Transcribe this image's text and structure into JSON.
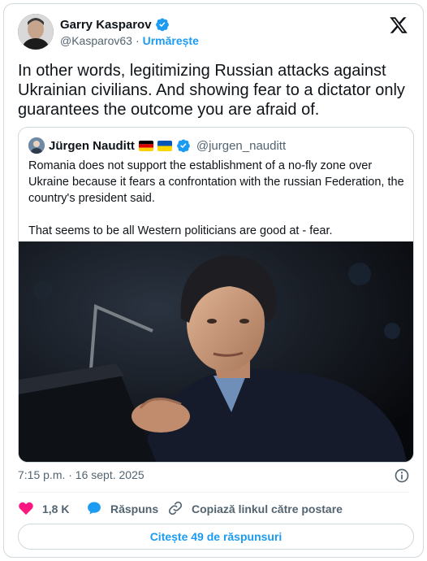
{
  "author": {
    "name": "Garry Kasparov",
    "handle": "@Kasparov63",
    "separator": "·",
    "follow_label": "Urmărește"
  },
  "tweet": {
    "text": "In other words, legitimizing Russian attacks against Ukrainian civilians. And showing fear to a dictator only guarantees the outcome you are afraid of."
  },
  "quote": {
    "name": "Jürgen Nauditt",
    "flags": [
      "germany-flag",
      "ukraine-flag"
    ],
    "handle": "@jurgen_nauditt",
    "text": "Romania does not support the establishment of a no-fly zone over Ukraine because it fears a confrontation with the russian Federation, the country's president said.\n\nThat seems to be all Western politicians are good at - fear."
  },
  "meta": {
    "timestamp": "7:15 p.m. · 16 sept. 2025"
  },
  "actions": {
    "like_count": "1,8 K",
    "reply_label": "Răspuns",
    "copy_label": "Copiază linkul către postare"
  },
  "read_replies_label": "Citește 49 de răspunsuri",
  "colors": {
    "accent": "#1d9bf0",
    "like": "#f91880",
    "text": "#0f1419",
    "muted": "#536471",
    "border": "#cfd9de"
  },
  "icons": [
    "x-logo-icon",
    "verified-badge-icon",
    "info-icon",
    "heart-icon",
    "reply-bubble-icon",
    "link-icon"
  ]
}
